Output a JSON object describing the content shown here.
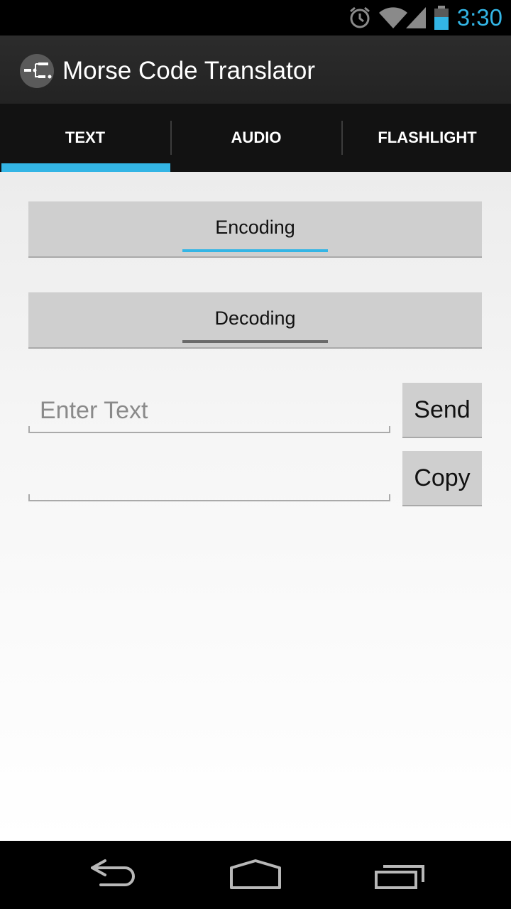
{
  "status_bar": {
    "time": "3:30",
    "icons": [
      "alarm-icon",
      "wifi-icon",
      "signal-icon",
      "battery-icon"
    ],
    "accent_color": "#33b5e5"
  },
  "app": {
    "title": "Morse Code Translator",
    "icon": "morse-app-icon"
  },
  "tabs": [
    {
      "label": "TEXT",
      "selected": true
    },
    {
      "label": "AUDIO",
      "selected": false
    },
    {
      "label": "FLASHLIGHT",
      "selected": false
    }
  ],
  "modes": {
    "encoding_label": "Encoding",
    "decoding_label": "Decoding",
    "selected": "Encoding"
  },
  "input": {
    "placeholder": "Enter Text",
    "value": ""
  },
  "output": {
    "value": ""
  },
  "buttons": {
    "send_label": "Send",
    "copy_label": "Copy"
  },
  "nav_bar": {
    "icons": [
      "back-icon",
      "home-icon",
      "recents-icon"
    ]
  }
}
